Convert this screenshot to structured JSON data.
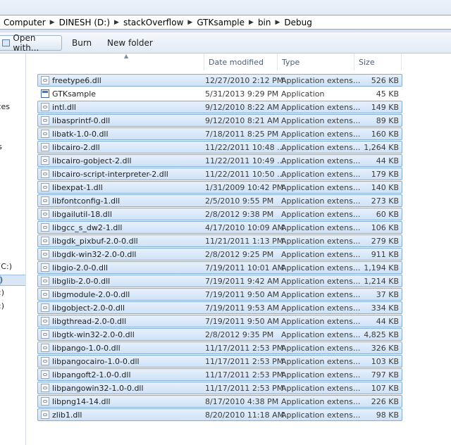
{
  "address_bar": {
    "crumbs": [
      "Computer",
      "DINESH (D:)",
      "stackOverflow",
      "GTKsample",
      "bin",
      "Debug"
    ]
  },
  "toolbar": {
    "open_with_label": "Open with...",
    "burn_label": "Burn",
    "new_folder_label": "New folder"
  },
  "nav_pane": {
    "fragments": [
      "ces",
      "s",
      "(C:)",
      ")",
      ":)",
      ":)"
    ]
  },
  "columns": {
    "name": "",
    "date": "Date modified",
    "type": "Type",
    "size": "Size"
  },
  "files": [
    {
      "name": "freetype6.dll",
      "date": "12/27/2010 2:12 PM",
      "type": "Application extens...",
      "size": "526 KB",
      "icon": "dll-file-icon",
      "selected": true
    },
    {
      "name": "GTKsample",
      "date": "5/31/2013 9:29 PM",
      "type": "Application",
      "size": "45 KB",
      "icon": "application-icon",
      "selected": false
    },
    {
      "name": "intl.dll",
      "date": "9/12/2010 8:22 AM",
      "type": "Application extens...",
      "size": "149 KB",
      "icon": "dll-file-icon",
      "selected": true
    },
    {
      "name": "libasprintf-0.dll",
      "date": "9/12/2010 8:21 AM",
      "type": "Application extens...",
      "size": "89 KB",
      "icon": "dll-file-icon",
      "selected": true
    },
    {
      "name": "libatk-1.0-0.dll",
      "date": "7/18/2011 8:25 PM",
      "type": "Application extens...",
      "size": "160 KB",
      "icon": "dll-file-icon",
      "selected": true
    },
    {
      "name": "libcairo-2.dll",
      "date": "11/22/2011 10:48 ...",
      "type": "Application extens...",
      "size": "1,264 KB",
      "icon": "dll-file-icon",
      "selected": true
    },
    {
      "name": "libcairo-gobject-2.dll",
      "date": "11/22/2011 10:49 ...",
      "type": "Application extens...",
      "size": "44 KB",
      "icon": "dll-file-icon",
      "selected": true
    },
    {
      "name": "libcairo-script-interpreter-2.dll",
      "date": "11/22/2011 10:50 ...",
      "type": "Application extens...",
      "size": "179 KB",
      "icon": "dll-file-icon",
      "selected": true
    },
    {
      "name": "libexpat-1.dll",
      "date": "1/31/2009 10:42 PM",
      "type": "Application extens...",
      "size": "140 KB",
      "icon": "dll-file-icon",
      "selected": true
    },
    {
      "name": "libfontconfig-1.dll",
      "date": "2/5/2010 9:55 PM",
      "type": "Application extens...",
      "size": "273 KB",
      "icon": "dll-file-icon",
      "selected": true
    },
    {
      "name": "libgailutil-18.dll",
      "date": "2/8/2012 9:38 PM",
      "type": "Application extens...",
      "size": "60 KB",
      "icon": "dll-file-icon",
      "selected": true
    },
    {
      "name": "libgcc_s_dw2-1.dll",
      "date": "4/17/2010 10:09 AM",
      "type": "Application extens...",
      "size": "106 KB",
      "icon": "dll-file-icon",
      "selected": true
    },
    {
      "name": "libgdk_pixbuf-2.0-0.dll",
      "date": "11/21/2011 1:13 PM",
      "type": "Application extens...",
      "size": "279 KB",
      "icon": "dll-file-icon",
      "selected": true
    },
    {
      "name": "libgdk-win32-2.0-0.dll",
      "date": "2/8/2012 9:25 PM",
      "type": "Application extens...",
      "size": "911 KB",
      "icon": "dll-file-icon",
      "selected": true
    },
    {
      "name": "libgio-2.0-0.dll",
      "date": "7/19/2011 10:01 AM",
      "type": "Application extens...",
      "size": "1,194 KB",
      "icon": "dll-file-icon",
      "selected": true
    },
    {
      "name": "libglib-2.0-0.dll",
      "date": "7/19/2011 9:42 AM",
      "type": "Application extens...",
      "size": "1,214 KB",
      "icon": "dll-file-icon",
      "selected": true
    },
    {
      "name": "libgmodule-2.0-0.dll",
      "date": "7/19/2011 9:50 AM",
      "type": "Application extens...",
      "size": "37 KB",
      "icon": "dll-file-icon",
      "selected": true
    },
    {
      "name": "libgobject-2.0-0.dll",
      "date": "7/19/2011 9:53 AM",
      "type": "Application extens...",
      "size": "334 KB",
      "icon": "dll-file-icon",
      "selected": true
    },
    {
      "name": "libgthread-2.0-0.dll",
      "date": "7/19/2011 9:50 AM",
      "type": "Application extens...",
      "size": "44 KB",
      "icon": "dll-file-icon",
      "selected": true
    },
    {
      "name": "libgtk-win32-2.0-0.dll",
      "date": "2/8/2012 9:35 PM",
      "type": "Application extens...",
      "size": "4,825 KB",
      "icon": "dll-file-icon",
      "selected": true
    },
    {
      "name": "libpango-1.0-0.dll",
      "date": "11/17/2011 2:53 PM",
      "type": "Application extens...",
      "size": "326 KB",
      "icon": "dll-file-icon",
      "selected": true
    },
    {
      "name": "libpangocairo-1.0-0.dll",
      "date": "11/17/2011 2:53 PM",
      "type": "Application extens...",
      "size": "103 KB",
      "icon": "dll-file-icon",
      "selected": true
    },
    {
      "name": "libpangoft2-1.0-0.dll",
      "date": "11/17/2011 2:53 PM",
      "type": "Application extens...",
      "size": "797 KB",
      "icon": "dll-file-icon",
      "selected": true
    },
    {
      "name": "libpangowin32-1.0-0.dll",
      "date": "11/17/2011 2:53 PM",
      "type": "Application extens...",
      "size": "107 KB",
      "icon": "dll-file-icon",
      "selected": true
    },
    {
      "name": "libpng14-14.dll",
      "date": "8/17/2010 4:38 PM",
      "type": "Application extens...",
      "size": "226 KB",
      "icon": "dll-file-icon",
      "selected": true
    },
    {
      "name": "zlib1.dll",
      "date": "8/20/2010 11:18 AM",
      "type": "Application extens...",
      "size": "98 KB",
      "icon": "dll-file-icon",
      "selected": true
    }
  ]
}
